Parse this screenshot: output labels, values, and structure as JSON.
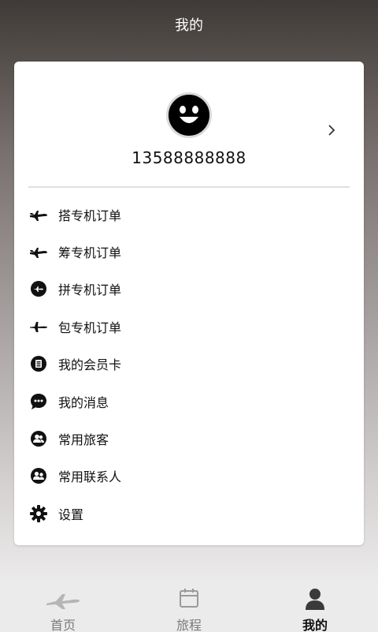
{
  "header": {
    "title": "我的"
  },
  "profile": {
    "phone": "13588888888"
  },
  "menu": [
    {
      "label": "搭专机订单",
      "icon": "plane-icon"
    },
    {
      "label": "筹专机订单",
      "icon": "plane-icon"
    },
    {
      "label": "拼专机订单",
      "icon": "plane-circle-icon"
    },
    {
      "label": "包专机订单",
      "icon": "plane-icon"
    },
    {
      "label": "我的会员卡",
      "icon": "card-icon"
    },
    {
      "label": "我的消息",
      "icon": "message-icon"
    },
    {
      "label": "常用旅客",
      "icon": "passenger-icon"
    },
    {
      "label": "常用联系人",
      "icon": "contact-icon"
    },
    {
      "label": "设置",
      "icon": "gear-icon"
    }
  ],
  "tabs": [
    {
      "label": "首页",
      "icon": "plane-icon",
      "active": false
    },
    {
      "label": "旅程",
      "icon": "calendar-icon",
      "active": false
    },
    {
      "label": "我的",
      "icon": "user-icon",
      "active": true
    }
  ],
  "colors": {
    "text": "#111111",
    "inactive_tab": "#7b7b7b",
    "card": "#ffffff"
  }
}
